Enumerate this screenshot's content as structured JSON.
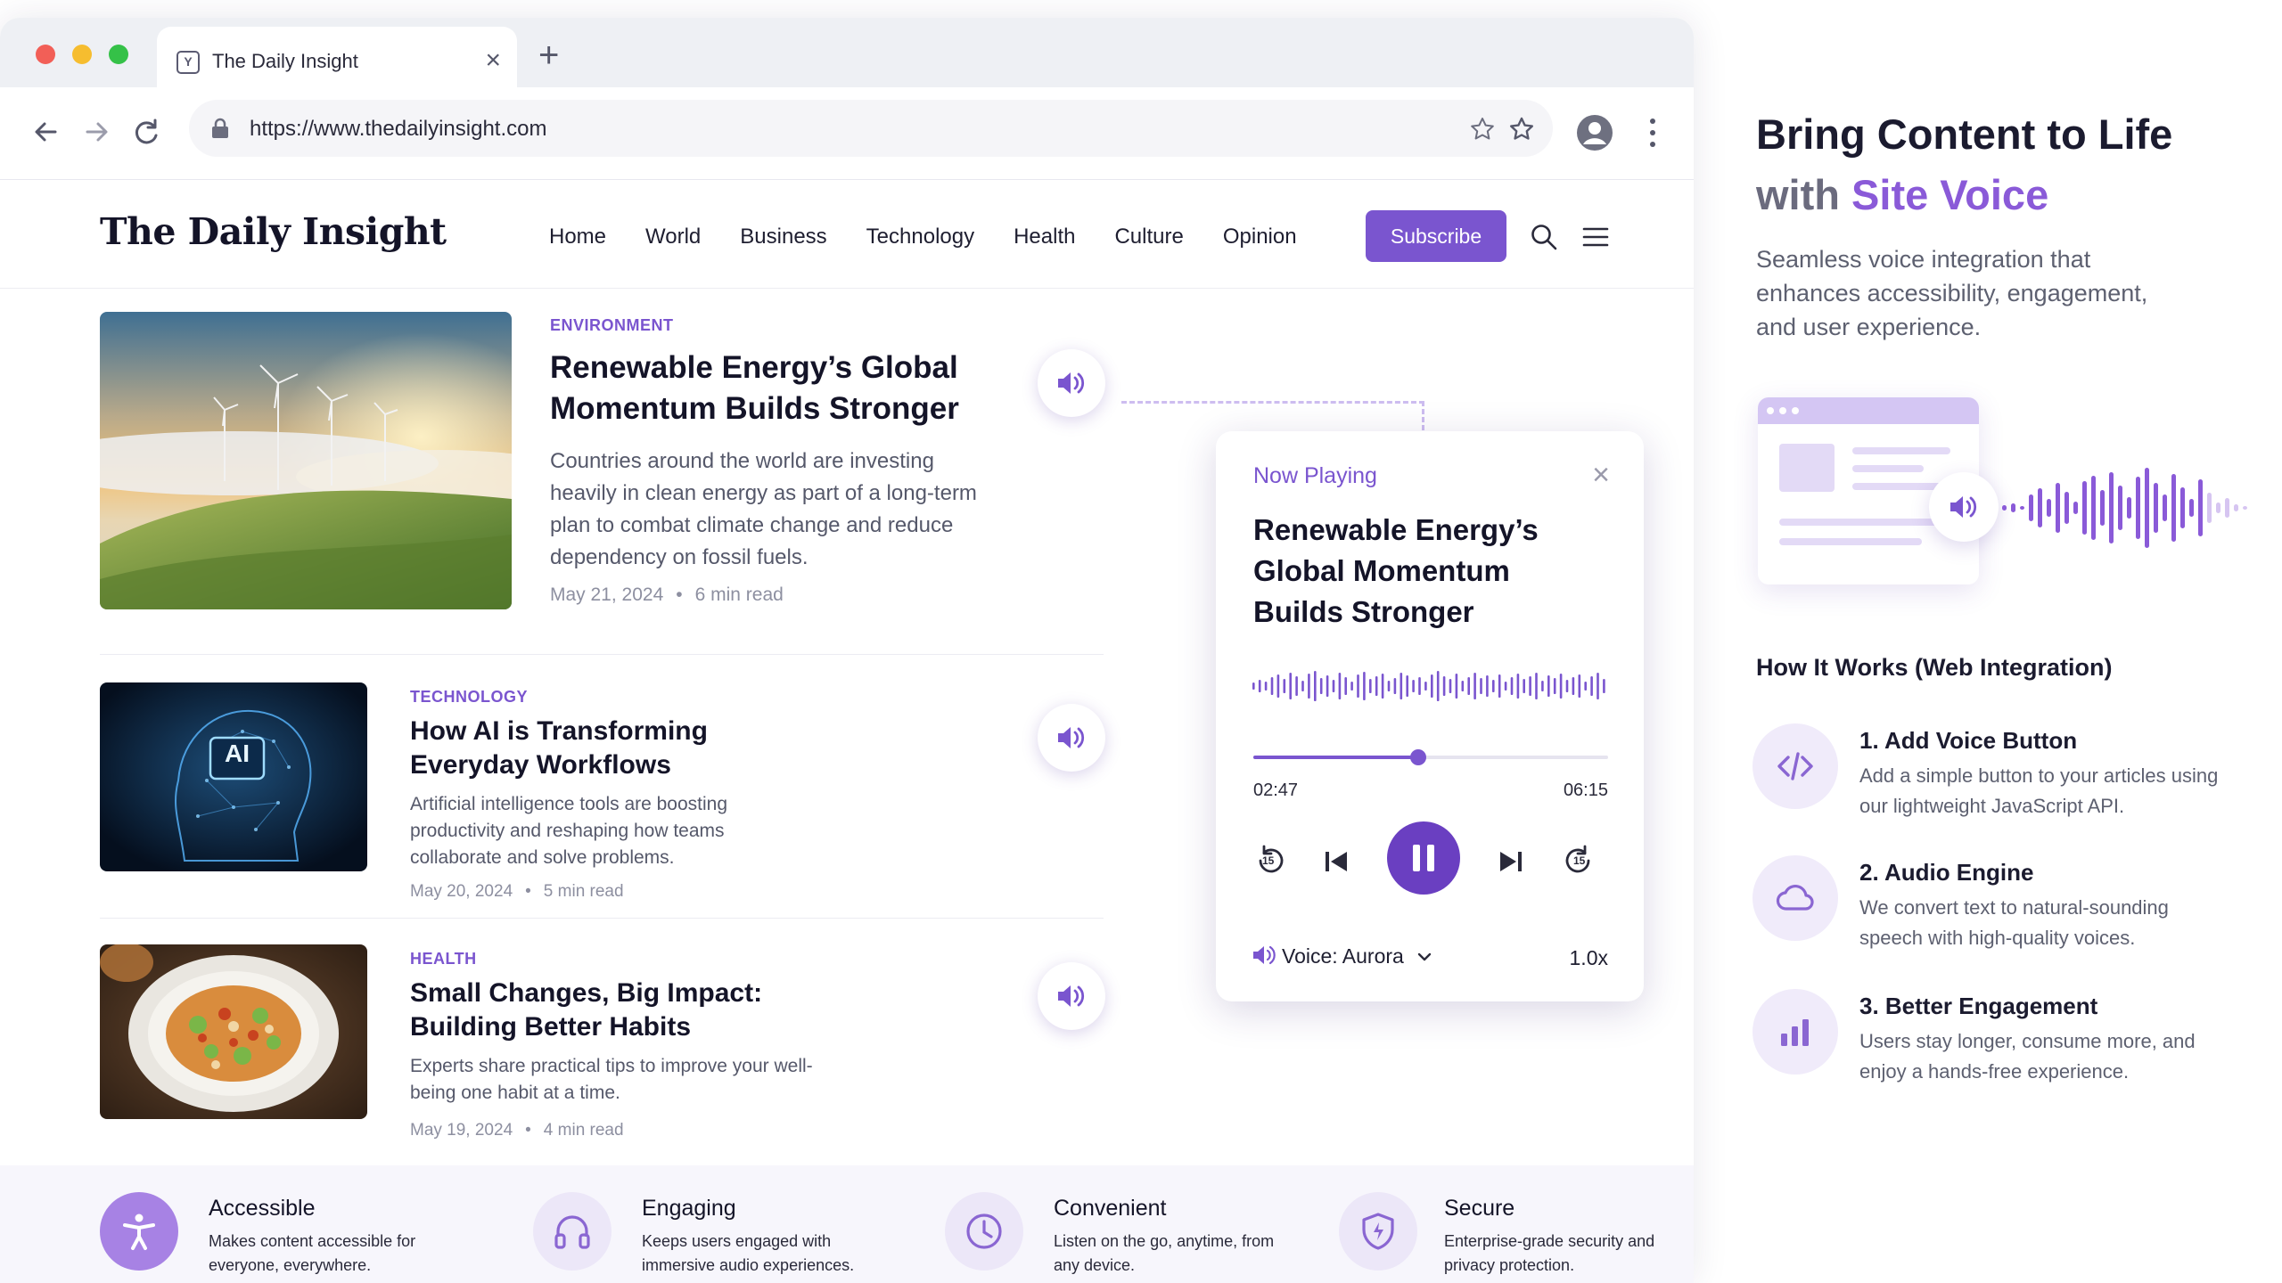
{
  "colors": {
    "accent": "#7a55cf",
    "accent_dark": "#6a3fc1",
    "accent_light": "#ece7f8",
    "text": "#141428",
    "muted": "#8d8fa0"
  },
  "browser": {
    "tab_title": "The Daily Insight",
    "favicon_letter": "Y",
    "url": "https://www.thedailyinsight.com"
  },
  "site": {
    "logo": "The Daily Insight",
    "nav": [
      "Home",
      "World",
      "Business",
      "Technology",
      "Health",
      "Culture",
      "Opinion"
    ],
    "subscribe": "Subscribe"
  },
  "articles": [
    {
      "category": "ENVIRONMENT",
      "title_line1": "Renewable Energy’s Global",
      "title_line2": "Momentum Builds Stronger",
      "excerpt": "Countries around the world are investing heavily in clean energy as part of a long-term plan to combat climate change and reduce dependency on fossil fuels.",
      "date": "May 21, 2024",
      "read": "6 min read",
      "image": "wind-turbines-photo"
    },
    {
      "category": "TECHNOLOGY",
      "title_line1": "How AI is Transforming",
      "title_line2": "Everyday Workflows",
      "excerpt": "Artificial intelligence tools are boosting productivity and reshaping how teams collaborate and solve problems.",
      "date": "May 20, 2024",
      "read": "5 min read",
      "image": "ai-head-photo",
      "image_label": "AI"
    },
    {
      "category": "HEALTH",
      "title_line1": "Small Changes, Big Impact:",
      "title_line2": "Building Better Habits",
      "excerpt": "Experts share practical tips to improve your well-being one habit at a time.",
      "date": "May 19, 2024",
      "read": "4 min read",
      "image": "salad-bowl-photo"
    }
  ],
  "player": {
    "label": "Now Playing",
    "title": "Renewable Energy’s Global Momentum Builds Stronger",
    "current_time": "02:47",
    "total_time": "06:15",
    "progress": 0.465,
    "skip_seconds": "15",
    "voice": "Voice: Aurora",
    "speed": "1.0x"
  },
  "features": [
    {
      "title": "Accessible",
      "desc": "Makes content accessible for everyone, everywhere.",
      "icon": "accessibility-icon"
    },
    {
      "title": "Engaging",
      "desc": "Keeps users engaged with immersive audio experiences.",
      "icon": "headphones-icon"
    },
    {
      "title": "Convenient",
      "desc": "Listen on the go, anytime, from any device.",
      "icon": "clock-icon"
    },
    {
      "title": "Secure",
      "desc": "Enterprise-grade security and privacy protection.",
      "icon": "shield-icon"
    }
  ],
  "panel": {
    "heading_line1": "Bring Content to Life",
    "heading_line2_prefix": "with ",
    "heading_line2_accent": "Site Voice",
    "subtitle": "Seamless voice integration that enhances accessibility, engagement, and user experience.",
    "how_title": "How It Works (Web Integration)",
    "steps": [
      {
        "title": "1. Add Voice Button",
        "desc": "Add a simple button to your articles using our lightweight JavaScript API.",
        "icon": "code-icon"
      },
      {
        "title": "2. Audio Engine",
        "desc": "We convert text to natural-sounding speech with high-quality voices.",
        "icon": "cloud-icon"
      },
      {
        "title": "3. Better Engagement",
        "desc": "Users stay longer, consume more, and enjoy a hands-free experience.",
        "icon": "bar-chart-icon"
      }
    ]
  }
}
